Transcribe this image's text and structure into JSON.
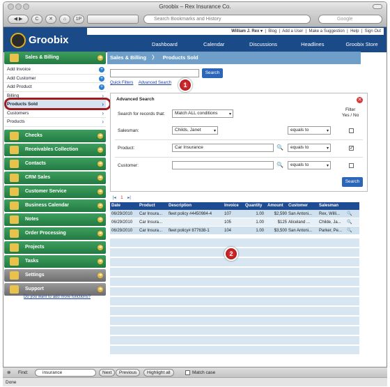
{
  "window": {
    "title": "Groobix – Rex Insurance Co."
  },
  "browser": {
    "back": "◀",
    "forward": "▶",
    "reload": "C",
    "stop": "✕",
    "home": "⌂",
    "onep": "1P",
    "address_placeholder": "Search Bookmarks and History",
    "search_placeholder": "Google"
  },
  "app": {
    "logo": "Groobix",
    "user": "William J. Rex ▾",
    "top_links": [
      "Blog",
      "Add a User",
      "Make a Suggestion",
      "Help",
      "Sign Out"
    ],
    "nav": [
      "Dashboard",
      "Calendar",
      "Discussions",
      "Headlines",
      "Groobix Store"
    ]
  },
  "sidebar": {
    "sales": "Sales & Billing",
    "sub": [
      {
        "label": "Add Invoice",
        "kind": "plus"
      },
      {
        "label": "Add Customer",
        "kind": "plus"
      },
      {
        "label": "Add Product",
        "kind": "plus"
      },
      {
        "label": "Billing",
        "kind": "chev"
      },
      {
        "label": "Products Sold",
        "kind": "chev"
      },
      {
        "label": "Customers",
        "kind": "chev"
      },
      {
        "label": "Products",
        "kind": "chev"
      }
    ],
    "sections": [
      "Checks",
      "Receivables Collection",
      "Contacts",
      "CRM Sales",
      "Customer Service",
      "Business Calendar",
      "Notes",
      "Order Processing",
      "Projects",
      "Tasks"
    ],
    "gray_sections": [
      "Settings",
      "Support"
    ],
    "more": "Do you want to add more functions?"
  },
  "main": {
    "crumb1": "Sales & Billing",
    "crumb2": "Products Sold",
    "search_btn": "Search",
    "quick_filters": "Quick Filters",
    "advanced_search": "Advanced Search",
    "badge1": "1",
    "badge2": "2"
  },
  "adv": {
    "title": "Advanced Search",
    "records_label": "Search for records that:",
    "records_value": "Match ALL conditions",
    "filter_head": "Filter\nYes / No",
    "rows": [
      {
        "label": "Salesman:",
        "value": "Childs, Janet",
        "op": "equals to",
        "checked": false
      },
      {
        "label": "Product:",
        "value": "Car Insurance",
        "op": "equals to",
        "checked": true
      },
      {
        "label": "Customer:",
        "value": "",
        "op": "equals to",
        "checked": false
      }
    ],
    "search_btn": "Search"
  },
  "pager": {
    "first": "|◂",
    "page": "1",
    "last": "▸|"
  },
  "table": {
    "headers": [
      "Date",
      "Product",
      "Description",
      "Invoice",
      "Quantity",
      "Amount",
      "Customer",
      "Salesman"
    ],
    "rows": [
      [
        "06/29/2010",
        "Car Insura...",
        "fleet policy #4450984-4",
        "107",
        "1.00",
        "$2,590",
        "San Antoni...",
        "Rex, Willi..."
      ],
      [
        "06/29/2010",
        "Car Insura...",
        "",
        "105",
        "1.00",
        "$125",
        "Aliceland ...",
        "Childe, Ja..."
      ],
      [
        "06/29/2010",
        "Car Insura...",
        "fleet policy# 877638-1",
        "104",
        "1.00",
        "$3,500",
        "San Antoni...",
        "Parker, Pe..."
      ]
    ]
  },
  "find": {
    "label": "Find:",
    "value": "insurance",
    "next": "Next",
    "prev": "Previous",
    "highlight": "Highlight all",
    "match": "Match case"
  },
  "status": "Done"
}
